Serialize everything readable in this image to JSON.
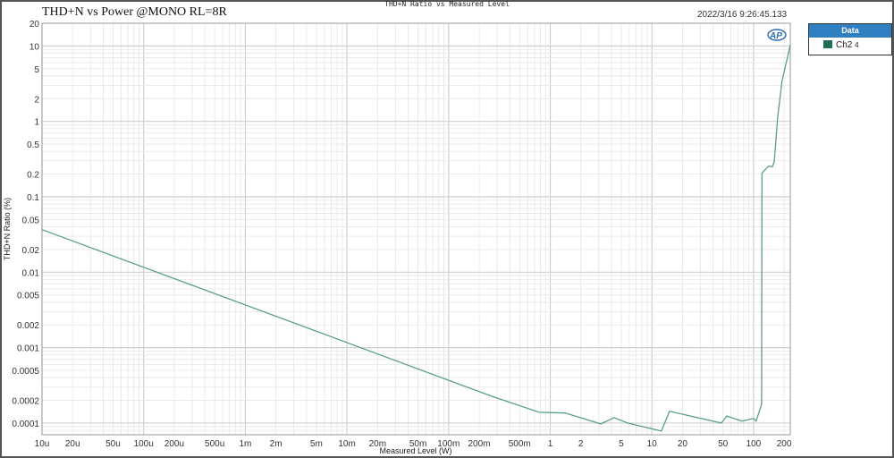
{
  "window_title": "THD+N Ratio vs Measured Level",
  "graph_title": "THD+N vs Power @MONO RL=8R",
  "timestamp": "2022/3/16 9:26:45.133",
  "logo_text": "AP",
  "legend": {
    "header": "Data",
    "items": [
      {
        "label": "Ch2",
        "suffix": "4",
        "color": "#1e6e56"
      }
    ]
  },
  "chart_data": {
    "type": "line",
    "xlabel": "Measured Level (W)",
    "ylabel": "THD+N Ratio (%)",
    "xscale": "log",
    "yscale": "log",
    "xlim": [
      1e-05,
      230
    ],
    "ylim": [
      7e-05,
      20
    ],
    "grid": true,
    "legend_position": "right",
    "x_ticks": [
      {
        "v": 1e-05,
        "label": "10u"
      },
      {
        "v": 2e-05,
        "label": "20u"
      },
      {
        "v": 5e-05,
        "label": "50u"
      },
      {
        "v": 0.0001,
        "label": "100u"
      },
      {
        "v": 0.0002,
        "label": "200u"
      },
      {
        "v": 0.0005,
        "label": "500u"
      },
      {
        "v": 0.001,
        "label": "1m"
      },
      {
        "v": 0.002,
        "label": "2m"
      },
      {
        "v": 0.005,
        "label": "5m"
      },
      {
        "v": 0.01,
        "label": "10m"
      },
      {
        "v": 0.02,
        "label": "20m"
      },
      {
        "v": 0.05,
        "label": "50m"
      },
      {
        "v": 0.1,
        "label": "100m"
      },
      {
        "v": 0.2,
        "label": "200m"
      },
      {
        "v": 0.5,
        "label": "500m"
      },
      {
        "v": 1,
        "label": "1"
      },
      {
        "v": 2,
        "label": "2"
      },
      {
        "v": 5,
        "label": "5"
      },
      {
        "v": 10,
        "label": "10"
      },
      {
        "v": 20,
        "label": "20"
      },
      {
        "v": 50,
        "label": "50"
      },
      {
        "v": 100,
        "label": "100"
      },
      {
        "v": 200,
        "label": "200"
      }
    ],
    "y_ticks": [
      {
        "v": 20,
        "label": "20"
      },
      {
        "v": 10,
        "label": "10"
      },
      {
        "v": 5,
        "label": "5"
      },
      {
        "v": 2,
        "label": "2"
      },
      {
        "v": 1,
        "label": "1"
      },
      {
        "v": 0.5,
        "label": "0.5"
      },
      {
        "v": 0.2,
        "label": "0.2"
      },
      {
        "v": 0.1,
        "label": "0.1"
      },
      {
        "v": 0.05,
        "label": "0.05"
      },
      {
        "v": 0.02,
        "label": "0.02"
      },
      {
        "v": 0.01,
        "label": "0.01"
      },
      {
        "v": 0.005,
        "label": "0.005"
      },
      {
        "v": 0.002,
        "label": "0.002"
      },
      {
        "v": 0.001,
        "label": "0.001"
      },
      {
        "v": 0.0005,
        "label": "0.0005"
      },
      {
        "v": 0.0002,
        "label": "0.0002"
      },
      {
        "v": 0.0001,
        "label": "0.0001"
      }
    ],
    "series": [
      {
        "name": "Ch2",
        "color": "#5a9e8f",
        "x": [
          1e-05,
          0.265,
          0.776,
          1.4,
          3.14,
          4.26,
          5.77,
          12.4,
          14.9,
          21.5,
          28.0,
          48.3,
          54.6,
          77.1,
          100,
          106,
          120,
          121,
          141,
          153,
          160,
          173,
          191,
          230
        ],
        "y": [
          0.0367,
          0.000227,
          0.000139,
          0.000136,
          9.73e-05,
          0.000118,
          0.0001,
          7.82e-05,
          0.000143,
          0.000128,
          0.000118,
          0.0001,
          0.000124,
          0.000106,
          0.000115,
          0.000106,
          0.000177,
          0.206,
          0.256,
          0.25,
          0.294,
          1.15,
          3.44,
          10.3
        ]
      }
    ]
  }
}
